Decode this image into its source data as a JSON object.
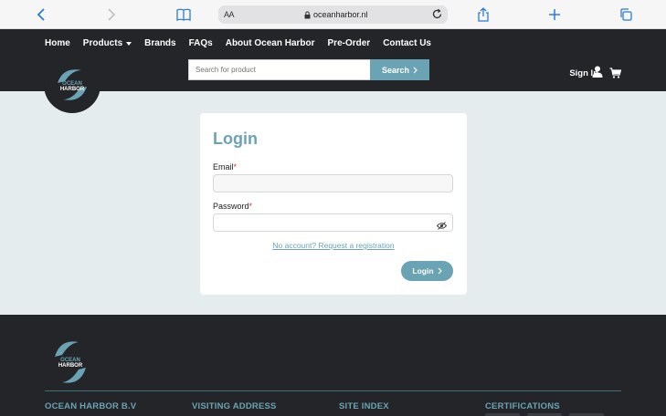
{
  "browser": {
    "text_size_label": "AA",
    "url": "oceanharbor.nl",
    "icons": [
      "back-icon",
      "forward-icon",
      "bookmarks-icon",
      "lock-icon",
      "reload-icon",
      "share-icon",
      "new-tab-icon",
      "tabs-icon"
    ]
  },
  "header": {
    "nav": [
      "Home",
      "Products",
      "Brands",
      "FAQs",
      "About Ocean Harbor",
      "Pre-Order",
      "Contact Us"
    ],
    "search_placeholder": "Search for product",
    "search_button": "Search",
    "sign_in": "Sign In",
    "logo_text": "OCEAN HARBOR"
  },
  "login": {
    "title": "Login",
    "email_label": "Email",
    "password_label": "Password",
    "required_marker": "*",
    "register_link": "No account? Request a registration",
    "login_button": "Login"
  },
  "footer": {
    "columns": [
      "OCEAN HARBOR B.V",
      "VISITING ADDRESS",
      "SITE INDEX",
      "CERTIFICATIONS"
    ]
  },
  "colors": {
    "accent": "#6aa3b3",
    "dark": "#232528",
    "page_bg": "#e4ecee"
  }
}
